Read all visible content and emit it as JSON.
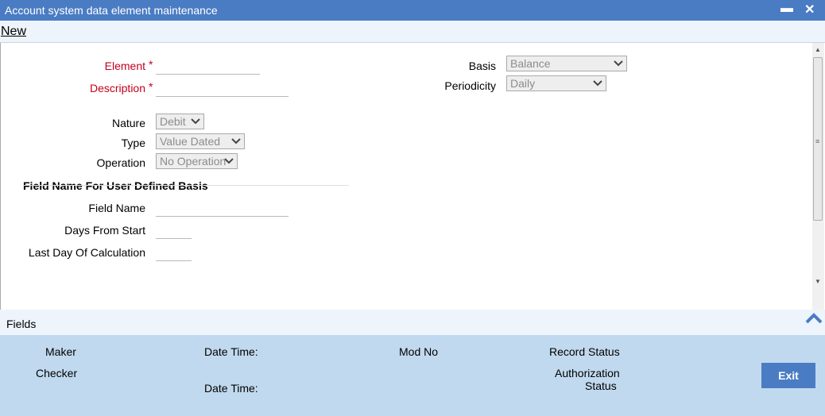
{
  "window": {
    "title": "Account system data element maintenance",
    "minimize": "▬",
    "close": "✕"
  },
  "menu": {
    "new": "New"
  },
  "form": {
    "element_label": "Element",
    "description_label": "Description",
    "required_mark": "*",
    "nature_label": "Nature",
    "nature_value": "Debit",
    "type_label": "Type",
    "type_value": "Value Dated",
    "operation_label": "Operation",
    "operation_value": "No Operation",
    "basis_label": "Basis",
    "basis_value": "Balance",
    "periodicity_label": "Periodicity",
    "periodicity_value": "Daily",
    "section_title": "Field Name For User Defined Basis",
    "field_name_label": "Field Name",
    "days_from_start_label": "Days From Start",
    "last_day_label": "Last Day Of Calculation"
  },
  "fields_bar": {
    "label": "Fields"
  },
  "audit": {
    "maker": "Maker",
    "checker": "Checker",
    "date_time_1": "Date Time:",
    "date_time_2": "Date Time:",
    "mod_no": "Mod No",
    "record_status": "Record Status",
    "authorization_line1": "Authorization",
    "authorization_line2": "Status",
    "exit": "Exit"
  },
  "colors": {
    "accent": "#4a7cc4",
    "required": "#c2001e",
    "audit_bg": "#c1d9ee"
  }
}
